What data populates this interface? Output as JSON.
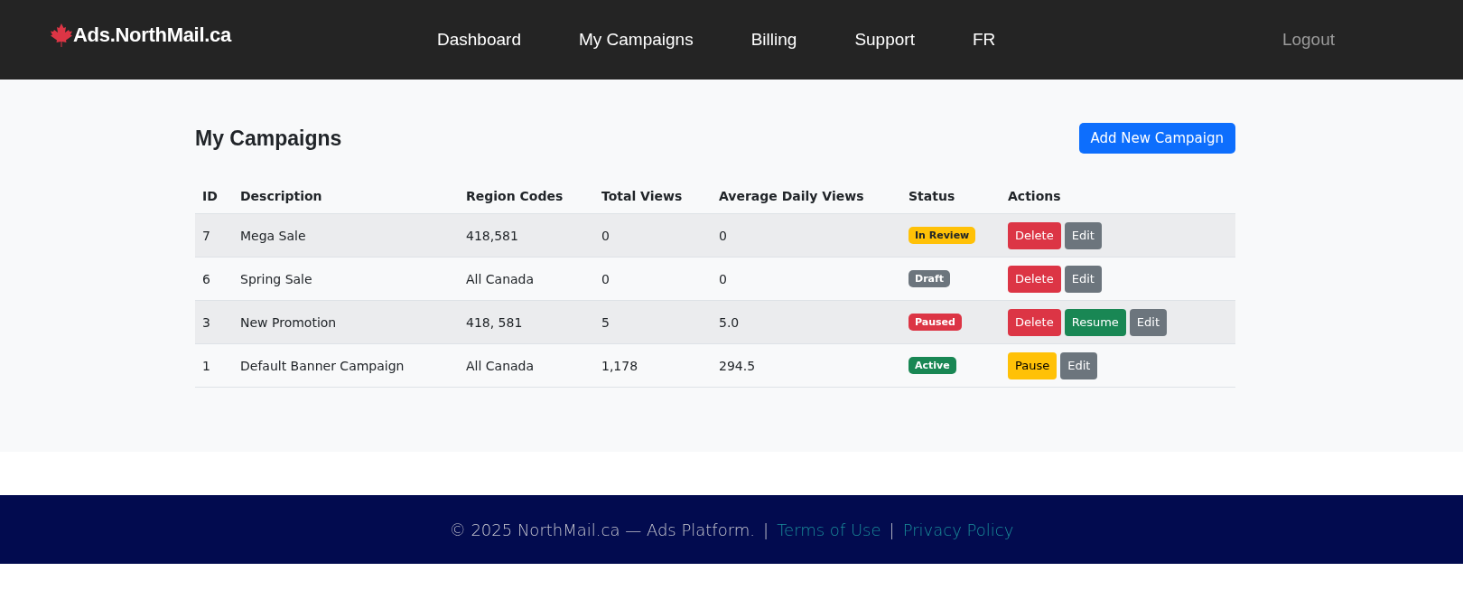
{
  "header": {
    "logo": "Ads.NorthMail.ca",
    "nav": [
      "Dashboard",
      "My Campaigns",
      "Billing",
      "Support",
      "FR"
    ],
    "logout": "Logout"
  },
  "page": {
    "title": "My Campaigns",
    "add_button": "Add New Campaign"
  },
  "table": {
    "columns": [
      "ID",
      "Description",
      "Region Codes",
      "Total Views",
      "Average Daily Views",
      "Status",
      "Actions"
    ],
    "rows": [
      {
        "id": "7",
        "description": "Mega Sale",
        "regions": "418,581",
        "total_views": "0",
        "avg_daily_views": "0",
        "status": {
          "label": "In Review",
          "kind": "review"
        },
        "actions": [
          {
            "label": "Delete",
            "kind": "danger"
          },
          {
            "label": "Edit",
            "kind": "secondary"
          }
        ]
      },
      {
        "id": "6",
        "description": "Spring Sale",
        "regions": "All Canada",
        "total_views": "0",
        "avg_daily_views": "0",
        "status": {
          "label": "Draft",
          "kind": "draft"
        },
        "actions": [
          {
            "label": "Delete",
            "kind": "danger"
          },
          {
            "label": "Edit",
            "kind": "secondary"
          }
        ]
      },
      {
        "id": "3",
        "description": "New Promotion",
        "regions": "418, 581",
        "total_views": "5",
        "avg_daily_views": "5.0",
        "status": {
          "label": "Paused",
          "kind": "paused"
        },
        "actions": [
          {
            "label": "Delete",
            "kind": "danger"
          },
          {
            "label": "Resume",
            "kind": "success"
          },
          {
            "label": "Edit",
            "kind": "secondary"
          }
        ]
      },
      {
        "id": "1",
        "description": "Default Banner Campaign",
        "regions": "All Canada",
        "total_views": "1,178",
        "avg_daily_views": "294.5",
        "status": {
          "label": "Active",
          "kind": "active"
        },
        "actions": [
          {
            "label": "Pause",
            "kind": "warning"
          },
          {
            "label": "Edit",
            "kind": "secondary"
          }
        ]
      }
    ]
  },
  "footer": {
    "text": "© 2025 NorthMail.ca — Ads Platform.",
    "separator_1": "|",
    "terms": "Terms of Use",
    "separator_2": "|",
    "privacy": "Privacy Policy"
  }
}
